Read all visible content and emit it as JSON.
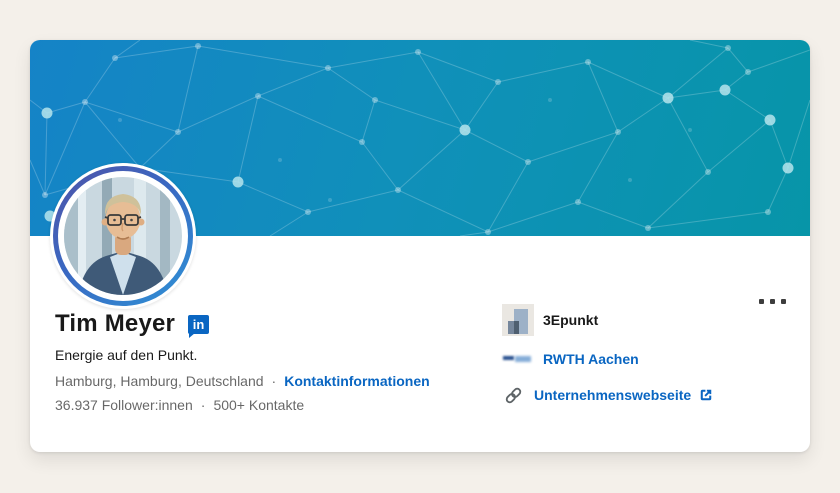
{
  "profile": {
    "name": "Tim Meyer",
    "badge": "in",
    "tagline": "Energie auf den Punkt.",
    "location": "Hamburg, Hamburg, Deutschland",
    "dot": "·",
    "contact_link": "Kontaktinformationen",
    "followers": "36.937 Follower:innen",
    "contacts": "500+ Kontakte"
  },
  "affiliations": {
    "company": {
      "name": "3Epunkt"
    },
    "education": {
      "name": "RWTH Aachen"
    },
    "website": {
      "label": "Unternehmenswebseite"
    }
  },
  "icons": {
    "linkedin_badge": "linkedin-badge-icon",
    "link": "link-icon",
    "external_link": "external-link-icon",
    "more": "more-ellipsis-icon",
    "external_glyph": "↗"
  },
  "colors": {
    "accent_blue": "#0a66c2",
    "banner_gradient_left": "#1583c7",
    "banner_gradient_right": "#0795a8",
    "page_background": "#f4f0ea",
    "card_background": "#ffffff",
    "text_primary": "rgba(0,0,0,0.9)",
    "text_secondary": "rgba(0,0,0,0.6)"
  }
}
